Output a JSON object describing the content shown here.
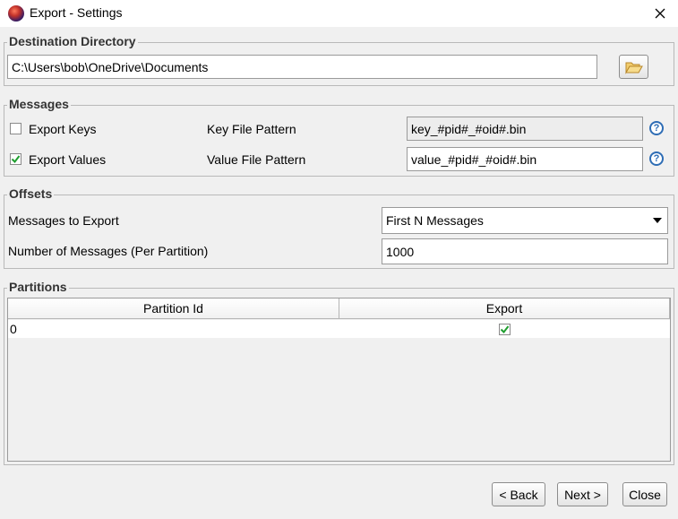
{
  "window": {
    "title": "Export - Settings",
    "close_label": "close"
  },
  "destination": {
    "group_title": "Destination Directory",
    "path": "C:\\Users\\bob\\OneDrive\\Documents",
    "browse_icon": "folder-open-icon"
  },
  "messages": {
    "group_title": "Messages",
    "export_keys_label": "Export Keys",
    "export_keys_checked": false,
    "export_values_label": "Export Values",
    "export_values_checked": true,
    "key_pattern_label": "Key File Pattern",
    "key_pattern_value": "key_#pid#_#oid#.bin",
    "value_pattern_label": "Value File Pattern",
    "value_pattern_value": "value_#pid#_#oid#.bin",
    "help_icon": "question-mark-icon"
  },
  "offsets": {
    "group_title": "Offsets",
    "messages_to_export_label": "Messages to Export",
    "messages_to_export_value": "First N Messages",
    "number_label": "Number of Messages (Per Partition)",
    "number_value": "1000"
  },
  "partitions": {
    "group_title": "Partitions",
    "columns": [
      "Partition Id",
      "Export"
    ],
    "rows": [
      {
        "partition_id": "0",
        "export": true
      }
    ]
  },
  "footer": {
    "back_label": "< Back",
    "next_label": "Next >",
    "close_label": "Close"
  },
  "colors": {
    "help_blue": "#2e6db5",
    "check_green": "#1e9e2e",
    "folder_yellow": "#e8b84a"
  }
}
